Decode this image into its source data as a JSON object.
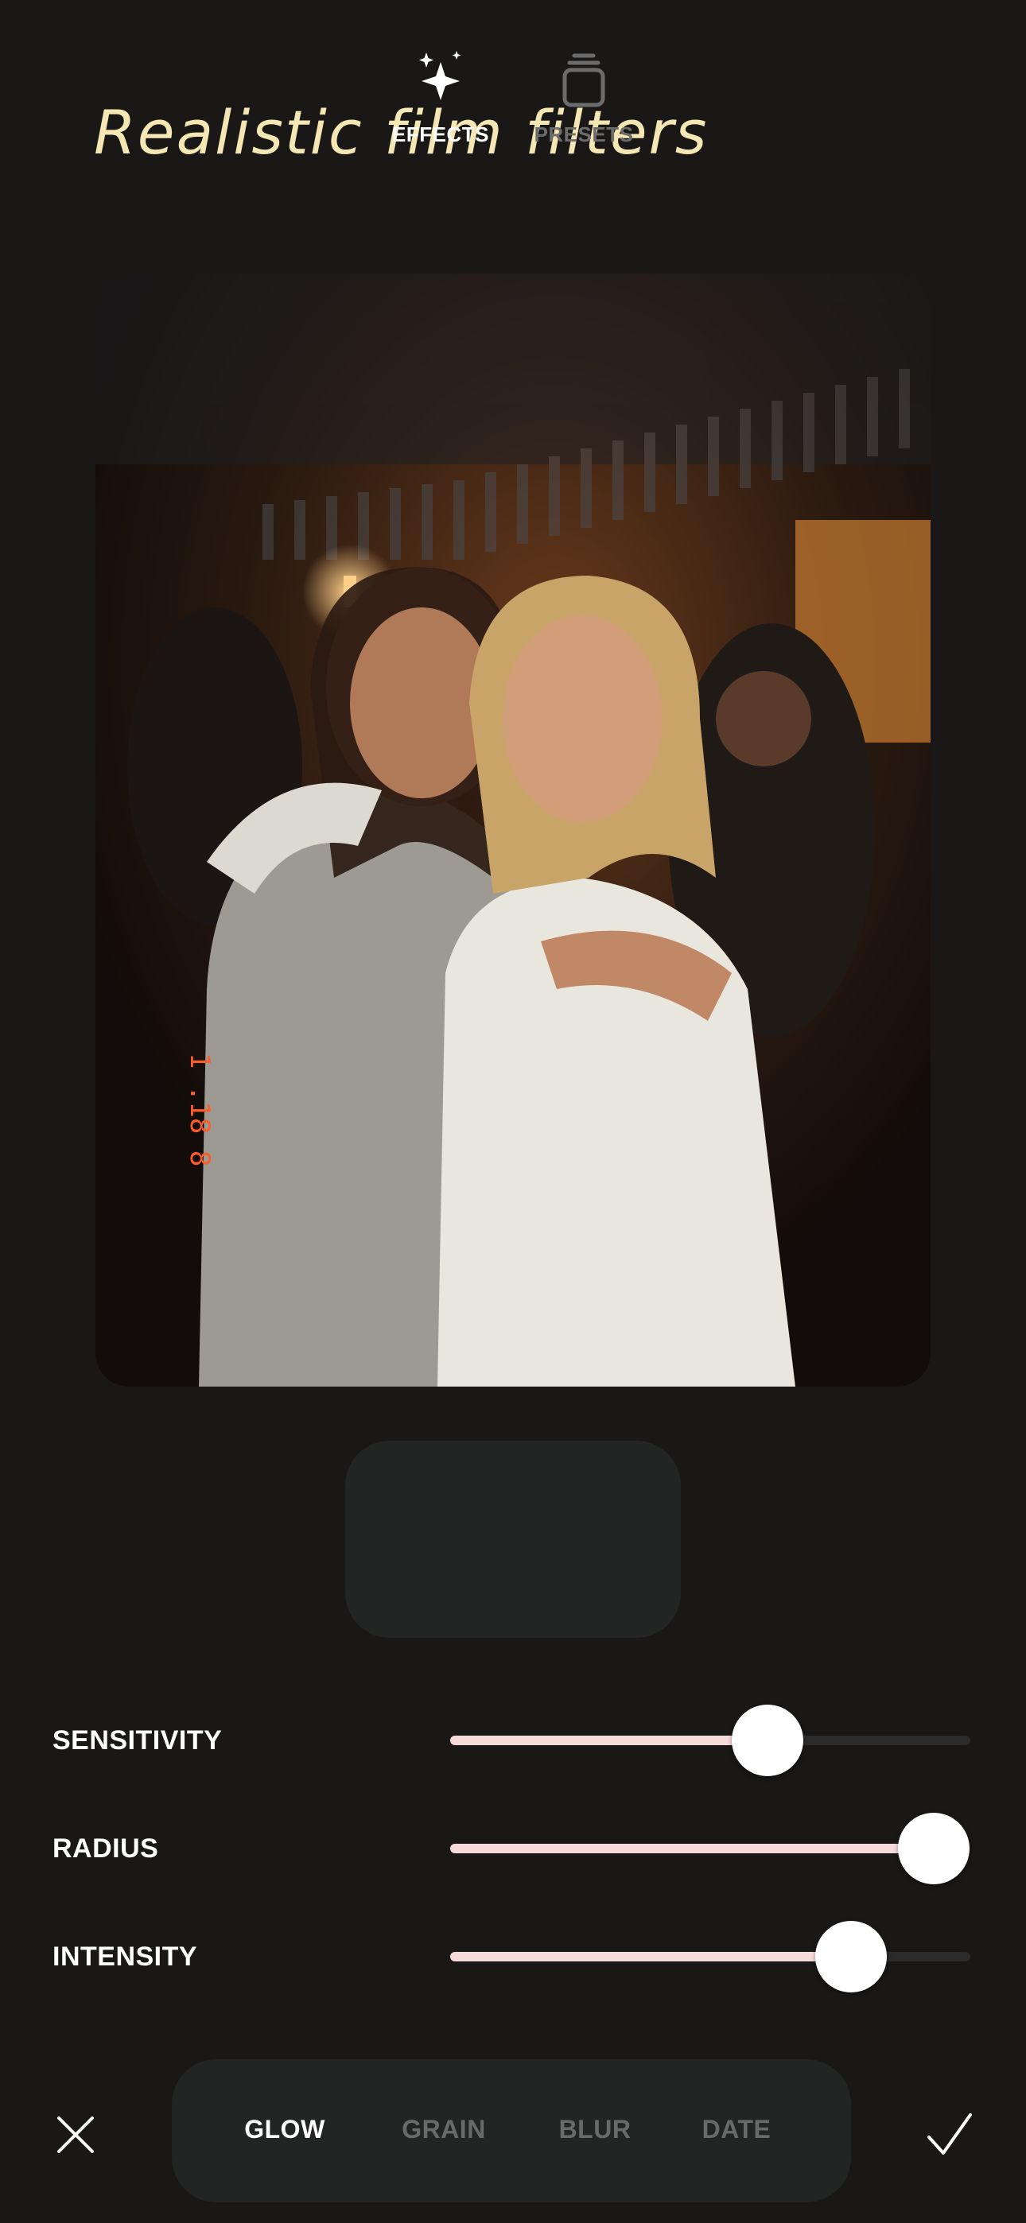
{
  "headline": "Realistic film filters",
  "photo": {
    "date_stamp": "1 .18 8"
  },
  "modes": [
    {
      "label": "EFFECTS",
      "icon": "sparkles-icon",
      "active": true
    },
    {
      "label": "PRESETS",
      "icon": "stack-icon",
      "active": false
    }
  ],
  "sliders": [
    {
      "label": "SENSITIVITY",
      "value": 0.61
    },
    {
      "label": "RADIUS",
      "value": 0.93
    },
    {
      "label": "INTENSITY",
      "value": 0.77
    }
  ],
  "tabs": [
    {
      "label": "GLOW",
      "active": true
    },
    {
      "label": "GRAIN",
      "active": false
    },
    {
      "label": "BLUR",
      "active": false
    },
    {
      "label": "DATE",
      "active": false
    }
  ],
  "actions": {
    "close_icon": "close-icon",
    "confirm_icon": "checkmark-icon"
  },
  "colors": {
    "background": "#191817",
    "headline": "#f4e7b3",
    "slider_fill": "#f8dada",
    "panel": "#232424",
    "date_stamp": "#ff5a2a"
  }
}
